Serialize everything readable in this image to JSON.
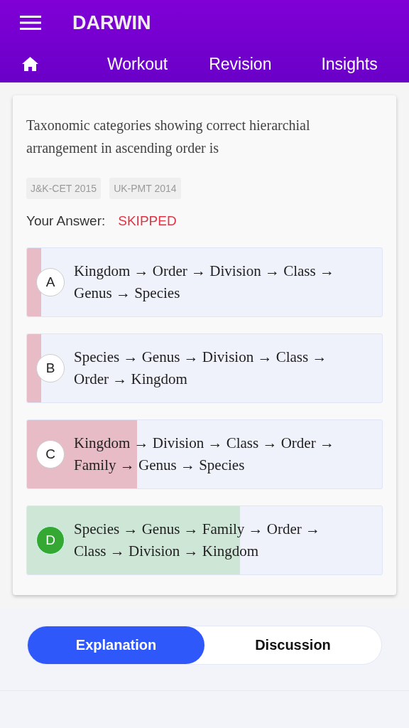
{
  "header": {
    "title": "DARWIN",
    "nav": [
      {
        "label": "Workout",
        "selected": false
      },
      {
        "label": "Revision",
        "selected": false
      },
      {
        "label": "Insights",
        "selected": false
      }
    ]
  },
  "question": {
    "text": "Taxonomic categories showing correct hierarchial arrangement in ascending order is",
    "tags": [
      "J&K-CET 2015",
      "UK-PMT 2014"
    ],
    "answer_label": "Your Answer:",
    "answer_value": "SKIPPED"
  },
  "options": [
    {
      "letter": "A",
      "text": "Kingdom → Order → Division → Class → Genus → Species",
      "level": 0.04,
      "correct": false
    },
    {
      "letter": "B",
      "text": "Species → Genus → Division → Class → Order → Kingdom",
      "level": 0.04,
      "correct": false
    },
    {
      "letter": "C",
      "text": "Kingdom → Division → Class → Order → Family → Genus → Species",
      "level": 0.31,
      "correct": false
    },
    {
      "letter": "D",
      "text": "Species → Genus → Family → Order → Class → Division → Kingdom",
      "level": 0.6,
      "correct": true
    }
  ],
  "tabs": [
    {
      "label": "Explanation",
      "selected": true
    },
    {
      "label": "Discussion",
      "selected": false
    }
  ]
}
